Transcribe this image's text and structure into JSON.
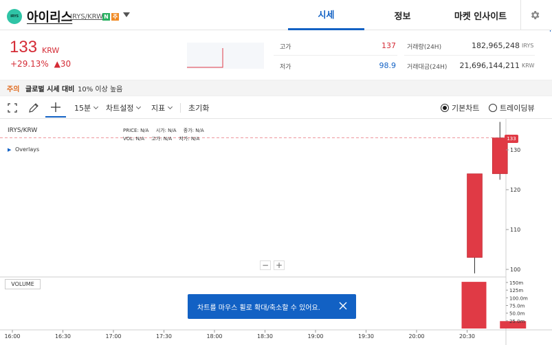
{
  "header": {
    "logo_text": "IRYS",
    "coin_name": "아이리스",
    "pair": "IRYS/KRW",
    "badge_n": "N",
    "badge_w": "주",
    "tabs": [
      "시세",
      "정보",
      "마켓 인사이트"
    ],
    "active_tab": "시세"
  },
  "price": {
    "current": "133",
    "unit": "KRW",
    "change_pct": "+29.13%",
    "change_amount": "▲30",
    "high_label": "고가",
    "high_value": "137",
    "low_label": "저가",
    "low_value": "98.9",
    "volume_label": "거래량(24H)",
    "volume_value": "182,965,248",
    "volume_unit": "IRYS",
    "amount_label": "거래대금(24H)",
    "amount_value": "21,696,144,211",
    "amount_unit": "KRW"
  },
  "caution": {
    "tag": "주의",
    "title": "글로벌 시세 대비",
    "detail": "10% 이상 높음"
  },
  "toolbar": {
    "interval": "15분",
    "chart_settings": "차트설정",
    "indicators": "지표",
    "reset": "초기화",
    "basic_chart": "기본차트",
    "tradingview": "트레이딩뷰",
    "selected_chart": "기본차트"
  },
  "chart": {
    "pair_label": "IRYS/KRW",
    "overlays_label": "Overlays",
    "ohlc_row1": [
      {
        "label": "PRICE:",
        "value": "N/A"
      },
      {
        "label": "시가:",
        "value": "N/A"
      },
      {
        "label": "종가:",
        "value": "N/A"
      }
    ],
    "ohlc_row2": [
      {
        "label": "VOL:",
        "value": "N/A"
      },
      {
        "label": "고가:",
        "value": "N/A"
      },
      {
        "label": "저가:",
        "value": "N/A"
      }
    ],
    "current_price_tag": "133",
    "volume_label": "VOLUME",
    "zoom_minus": "−",
    "zoom_plus": "+",
    "toast": "차트를 마우스 휠로 확대/축소할 수 있어요.",
    "colors": {
      "up": "#e03a45",
      "accent": "#1261c4"
    }
  },
  "chart_data": {
    "type": "bar",
    "price_axis": {
      "ticks": [
        100,
        110,
        120,
        130
      ],
      "range": [
        95,
        137
      ]
    },
    "volume_axis": {
      "ticks": [
        "150m",
        "125m",
        "100.0m",
        "75.0m",
        "50.0m",
        "25.0m"
      ],
      "range": [
        0,
        160
      ]
    },
    "x_ticks": [
      "16:00",
      "16:30",
      "17:00",
      "17:30",
      "18:00",
      "18:30",
      "19:00",
      "19:30",
      "20:00",
      "20:30"
    ],
    "candles": [
      {
        "time": "20:30",
        "open": 103,
        "close": 124,
        "high": 124,
        "low": 99
      },
      {
        "time": "20:45",
        "open": 124,
        "close": 133,
        "high": 137,
        "low": 122.5
      }
    ],
    "volume": [
      {
        "time": "20:30",
        "value": 152
      },
      {
        "time": "20:45",
        "value": 24
      }
    ],
    "current_price": 133
  }
}
